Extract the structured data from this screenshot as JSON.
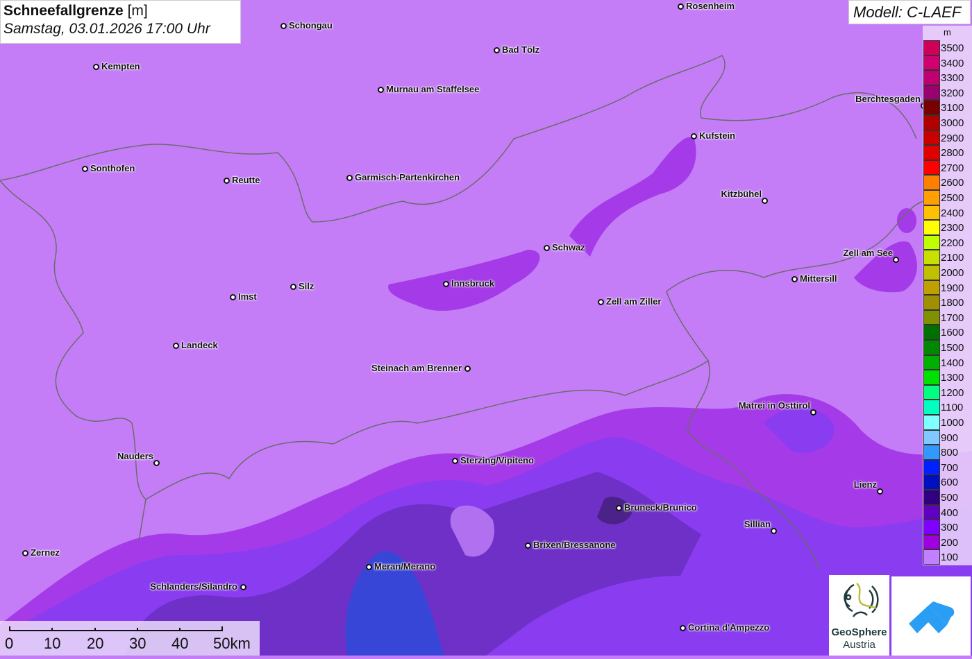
{
  "title": {
    "main": "Schneefallgrenze",
    "unit": "[m]",
    "subtitle": "Samstag, 03.01.2026 17:00 Uhr"
  },
  "model": "Modell: C-LAEF",
  "legend": {
    "unit": "m",
    "items": [
      {
        "value": "3500",
        "color": "#d0005a"
      },
      {
        "value": "3400",
        "color": "#d00070"
      },
      {
        "value": "3300",
        "color": "#c00070"
      },
      {
        "value": "3200",
        "color": "#9a0070"
      },
      {
        "value": "3100",
        "color": "#780000"
      },
      {
        "value": "3000",
        "color": "#b00000"
      },
      {
        "value": "2900",
        "color": "#c80000"
      },
      {
        "value": "2800",
        "color": "#e00000"
      },
      {
        "value": "2700",
        "color": "#ff0000"
      },
      {
        "value": "2600",
        "color": "#ff8000"
      },
      {
        "value": "2500",
        "color": "#ffa000"
      },
      {
        "value": "2400",
        "color": "#ffc000"
      },
      {
        "value": "2300",
        "color": "#ffff00"
      },
      {
        "value": "2200",
        "color": "#c0ff00"
      },
      {
        "value": "2100",
        "color": "#c8e000"
      },
      {
        "value": "2000",
        "color": "#c0c000"
      },
      {
        "value": "1900",
        "color": "#c0a000"
      },
      {
        "value": "1800",
        "color": "#a09000"
      },
      {
        "value": "1700",
        "color": "#809000"
      },
      {
        "value": "1600",
        "color": "#007000"
      },
      {
        "value": "1500",
        "color": "#008800"
      },
      {
        "value": "1400",
        "color": "#00b000"
      },
      {
        "value": "1300",
        "color": "#00e000"
      },
      {
        "value": "1200",
        "color": "#00ff80"
      },
      {
        "value": "1100",
        "color": "#00ffc0"
      },
      {
        "value": "1000",
        "color": "#80ffff"
      },
      {
        "value": "900",
        "color": "#80c8ff"
      },
      {
        "value": "800",
        "color": "#3098ff"
      },
      {
        "value": "700",
        "color": "#0020ff"
      },
      {
        "value": "600",
        "color": "#0010c0"
      },
      {
        "value": "500",
        "color": "#300080"
      },
      {
        "value": "400",
        "color": "#6000c0"
      },
      {
        "value": "300",
        "color": "#8000ff"
      },
      {
        "value": "200",
        "color": "#a000e0"
      },
      {
        "value": "100",
        "color": "#c080ff"
      }
    ]
  },
  "cities": [
    "Rosenheim",
    "Schongau",
    "Bad Tölz",
    "Kempten",
    "Murnau am Staffelsee",
    "Berchtesgaden",
    "Kufstein",
    "Sonthofen",
    "Reutte",
    "Garmisch-Partenkirchen",
    "Kitzbühel",
    "Schwaz",
    "Zell am See",
    "Innsbruck",
    "Mittersill",
    "Silz",
    "Imst",
    "Zell am Ziller",
    "Landeck",
    "Steinach am Brenner",
    "Matrei in Osttirol",
    "Nauders",
    "Sterzing/Vipiteno",
    "Lienz",
    "Bruneck/Brunico",
    "Sillian",
    "Brixen/Bressanone",
    "Zernez",
    "Meran/Merano",
    "Schlanders/Silandro",
    "Cortina d'Ampezzo"
  ],
  "scale": {
    "labels": [
      "0",
      "10",
      "20",
      "30",
      "40",
      "50km"
    ]
  },
  "logos": {
    "geosphere_line1": "GeoSphere",
    "geosphere_line2": "Austria"
  }
}
